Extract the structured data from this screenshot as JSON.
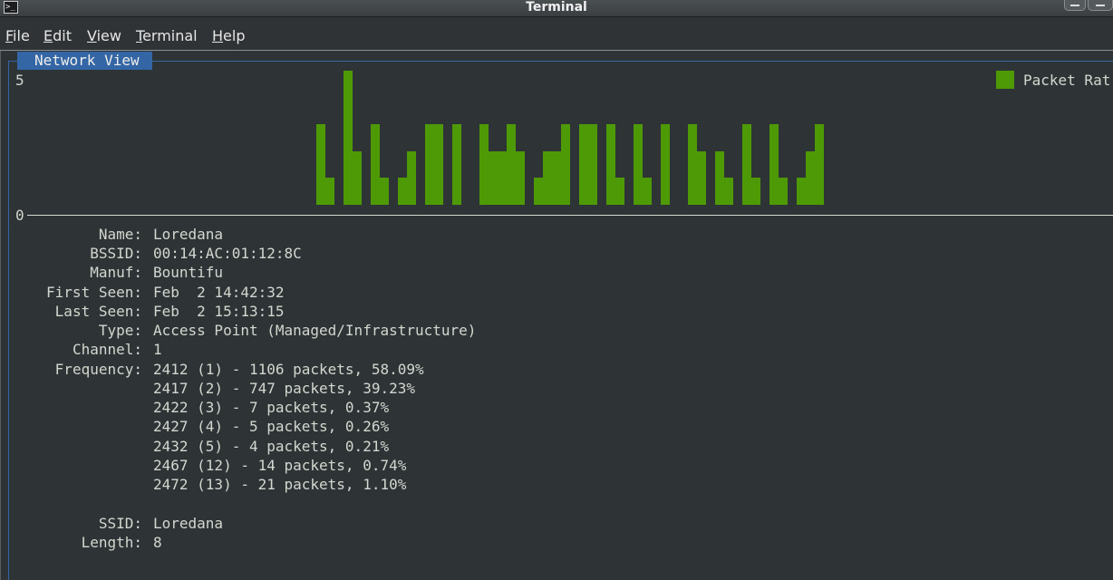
{
  "window": {
    "title": "Terminal"
  },
  "menu": [
    "File",
    "Edit",
    "View",
    "Terminal",
    "Help"
  ],
  "panel": {
    "title": "Network View"
  },
  "graph": {
    "legend": "Packet Rat",
    "y_max_label": "5",
    "y_min_label": "0",
    "color": "#4e9a06",
    "max": 5
  },
  "chart_data": {
    "type": "bar",
    "title": "",
    "legend": [
      "Packet Rat"
    ],
    "ylim": [
      0,
      5
    ],
    "values": [
      3,
      1,
      0,
      5,
      2,
      0,
      3,
      1,
      0,
      1,
      2,
      0,
      3,
      3,
      0,
      3,
      0,
      0,
      3,
      2,
      2,
      3,
      2,
      0,
      1,
      2,
      2,
      3,
      0,
      3,
      3,
      0,
      3,
      1,
      0,
      3,
      1,
      0,
      3,
      0,
      0,
      3,
      2,
      0,
      2,
      1,
      0,
      3,
      1,
      0,
      3,
      1,
      0,
      1,
      2,
      3
    ]
  },
  "info": {
    "name": {
      "label": "Name:",
      "value": "Loredana"
    },
    "bssid": {
      "label": "BSSID:",
      "value": "00:14:AC:01:12:8C"
    },
    "manuf": {
      "label": "Manuf:",
      "value": "Bountifu"
    },
    "first_seen": {
      "label": "First Seen:",
      "value": "Feb  2 14:42:32"
    },
    "last_seen": {
      "label": "Last Seen:",
      "value": "Feb  2 15:13:15"
    },
    "type": {
      "label": "Type:",
      "value": "Access Point (Managed/Infrastructure)"
    },
    "channel": {
      "label": "Channel:",
      "value": "1"
    },
    "frequency": {
      "label": "Frequency:",
      "rows": [
        "2412 (1) - 1106 packets, 58.09%",
        "2417 (2) - 747 packets, 39.23%",
        "2422 (3) - 7 packets, 0.37%",
        "2427 (4) - 5 packets, 0.26%",
        "2432 (5) - 4 packets, 0.21%",
        "2467 (12) - 14 packets, 0.74%",
        "2472 (13) - 21 packets, 1.10%"
      ]
    },
    "ssid": {
      "label": "SSID:",
      "value": "Loredana"
    },
    "length": {
      "label": "Length:",
      "value": "8"
    }
  }
}
